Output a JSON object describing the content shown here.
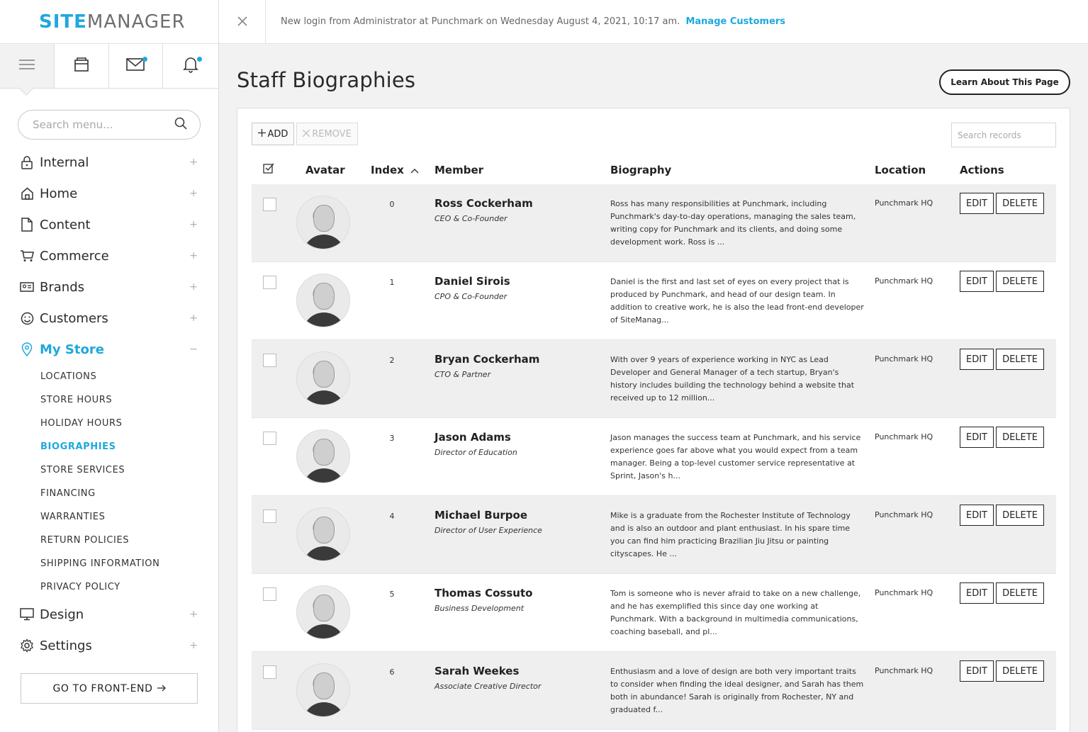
{
  "app": {
    "logo_site": "SITE",
    "logo_manager": "MANAGER"
  },
  "topbar": {
    "close_icon": "close-icon",
    "message": "New login from Administrator at Punchmark on Wednesday August 4, 2021, 10:17 am.",
    "link": "Manage Customers"
  },
  "iconbar": [
    {
      "icon": "hamburger-menu-icon",
      "badge": false
    },
    {
      "icon": "store-icon",
      "badge": false
    },
    {
      "icon": "mail-icon",
      "badge": true
    },
    {
      "icon": "bell-icon",
      "badge": true
    }
  ],
  "sidebar": {
    "search_placeholder": "Search menu...",
    "items": [
      {
        "label": "Internal",
        "icon": "lock-icon",
        "toggle": "+"
      },
      {
        "label": "Home",
        "icon": "home-icon",
        "toggle": "+"
      },
      {
        "label": "Content",
        "icon": "document-icon",
        "toggle": "+"
      },
      {
        "label": "Commerce",
        "icon": "cart-icon",
        "toggle": "+"
      },
      {
        "label": "Brands",
        "icon": "id-card-icon",
        "toggle": "+"
      },
      {
        "label": "Customers",
        "icon": "smile-icon",
        "toggle": "+"
      },
      {
        "label": "My Store",
        "icon": "location-pin-icon",
        "toggle": "−"
      }
    ],
    "sub_items": [
      "LOCATIONS",
      "STORE HOURS",
      "HOLIDAY HOURS",
      "BIOGRAPHIES",
      "STORE SERVICES",
      "FINANCING",
      "WARRANTIES",
      "RETURN POLICIES",
      "SHIPPING INFORMATION",
      "PRIVACY POLICY"
    ],
    "active_sub": "BIOGRAPHIES",
    "items_after": [
      {
        "label": "Design",
        "icon": "monitor-icon",
        "toggle": "+"
      },
      {
        "label": "Settings",
        "icon": "gear-icon",
        "toggle": "+"
      }
    ],
    "frontend_button": "GO TO FRONT-END"
  },
  "page": {
    "title": "Staff Biographies",
    "learn_button": "Learn About This Page"
  },
  "toolbar": {
    "add_label": "ADD",
    "remove_label": "REMOVE",
    "search_placeholder": "Search records"
  },
  "table": {
    "headers": {
      "avatar": "Avatar",
      "index": "Index",
      "member": "Member",
      "biography": "Biography",
      "location": "Location",
      "actions": "Actions"
    },
    "edit_label": "EDIT",
    "delete_label": "DELETE",
    "rows": [
      {
        "index": "0",
        "name": "Ross Cockerham",
        "role": "CEO & Co-Founder",
        "bio": "Ross has many responsibilities at Punchmark, including Punchmark's day-to-day operations, managing the sales team, writing copy for Punchmark and its clients, and doing some development work. Ross is ...",
        "location": "Punchmark HQ"
      },
      {
        "index": "1",
        "name": "Daniel Sirois",
        "role": "CPO & Co-Founder",
        "bio": "Daniel is the first and last set of eyes on every project that is produced by Punchmark, and head of our design team. In addition to creative work, he is also the lead front-end developer of SiteManag...",
        "location": "Punchmark HQ"
      },
      {
        "index": "2",
        "name": "Bryan Cockerham",
        "role": "CTO & Partner",
        "bio": "With over 9 years of experience working in NYC as Lead Developer and General Manager of a tech startup, Bryan's history includes building the technology behind a website that received up to 12 million...",
        "location": "Punchmark HQ"
      },
      {
        "index": "3",
        "name": "Jason Adams",
        "role": "Director of Education",
        "bio": "Jason manages the success team at Punchmark, and his service experience goes far above what you would expect from a team manager. Being a top-level customer service representative at Sprint, Jason's h...",
        "location": "Punchmark HQ"
      },
      {
        "index": "4",
        "name": "Michael Burpoe",
        "role": "Director of User Experience",
        "bio": "Mike is a graduate from the Rochester Institute of Technology and is also an outdoor and plant enthusiast. In his spare time you can find him practicing Brazilian Jiu Jitsu or painting cityscapes. He ...",
        "location": "Punchmark HQ"
      },
      {
        "index": "5",
        "name": "Thomas Cossuto",
        "role": "Business Development",
        "bio": "Tom is someone who is never afraid to take on a new challenge, and he has exemplified this since day one working at Punchmark. With a background in multimedia communications, coaching baseball, and pl...",
        "location": "Punchmark HQ"
      },
      {
        "index": "6",
        "name": "Sarah Weekes",
        "role": "Associate Creative Director",
        "bio": "Enthusiasm and a love of design are both very important traits to consider when finding the ideal designer, and Sarah has them both in abundance! Sarah is originally from Rochester, NY and graduated f...",
        "location": "Punchmark HQ"
      }
    ]
  },
  "colors": {
    "accent": "#1fa8dd",
    "row_alt": "#efefef"
  }
}
